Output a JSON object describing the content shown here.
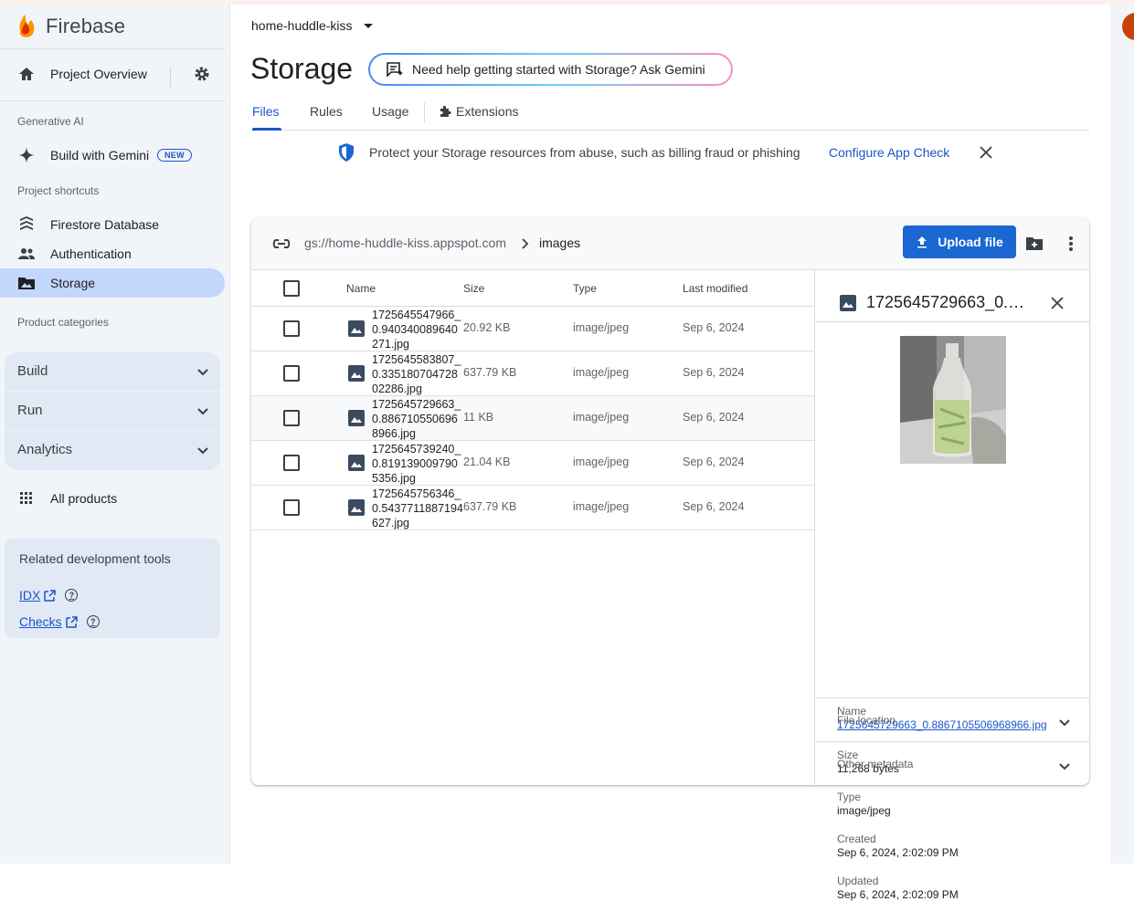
{
  "brand": {
    "name": "Firebase"
  },
  "sidebar": {
    "project_overview": "Project Overview",
    "generative_ai_label": "Generative AI",
    "build_with_gemini": "Build with Gemini",
    "new_badge": "NEW",
    "shortcuts_label": "Project shortcuts",
    "shortcuts": [
      "Firestore Database",
      "Authentication",
      "Storage"
    ],
    "categories_label": "Product categories",
    "categories": [
      "Build",
      "Run",
      "Analytics"
    ],
    "all_products": "All products",
    "related": {
      "title": "Related development tools",
      "links": [
        "IDX",
        "Checks"
      ]
    }
  },
  "header": {
    "project": "home-huddle-kiss",
    "title": "Storage",
    "gemini_prompt": "Need help getting started with Storage? Ask Gemini"
  },
  "tabs": [
    "Files",
    "Rules",
    "Usage",
    "Extensions"
  ],
  "banner": {
    "text": "Protect your Storage resources from abuse, such as billing fraud or phishing",
    "link": "Configure App Check"
  },
  "browser": {
    "bucket": "gs://home-huddle-kiss.appspot.com",
    "folder": "images",
    "upload_label": "Upload file",
    "columns": [
      "Name",
      "Size",
      "Type",
      "Last modified"
    ],
    "rows": [
      {
        "name": "1725645547966_0.940340089640271.jpg",
        "size": "20.92 KB",
        "type": "image/jpeg",
        "modified": "Sep 6, 2024"
      },
      {
        "name": "1725645583807_0.33518070472802286.jpg",
        "size": "637.79 KB",
        "type": "image/jpeg",
        "modified": "Sep 6, 2024"
      },
      {
        "name": "1725645729663_0.8867105506968966.jpg",
        "size": "11 KB",
        "type": "image/jpeg",
        "modified": "Sep 6, 2024"
      },
      {
        "name": "1725645739240_0.8191390097905356.jpg",
        "size": "21.04 KB",
        "type": "image/jpeg",
        "modified": "Sep 6, 2024"
      },
      {
        "name": "1725645756346_0.5437711887194627.jpg",
        "size": "637.79 KB",
        "type": "image/jpeg",
        "modified": "Sep 6, 2024"
      }
    ]
  },
  "detail": {
    "title": "1725645729663_0.886710550696896​6.jpg",
    "title_short": "1725645729663_0.…",
    "name_label": "Name",
    "name_value": "1725645729663_0.8867105506968966.jpg",
    "size_label": "Size",
    "size_value": "11,268 bytes",
    "type_label": "Type",
    "type_value": "image/jpeg",
    "created_label": "Created",
    "created_value": "Sep 6, 2024, 2:02:09 PM",
    "updated_label": "Updated",
    "updated_value": "Sep 6, 2024, 2:02:09 PM",
    "sections": [
      "File location",
      "Other metadata"
    ]
  },
  "colors": {
    "accent": "#1a67d2",
    "link": "#1a56c9",
    "sidebar_bg": "#f1f4f9",
    "active_nav": "#c2d7fb"
  }
}
